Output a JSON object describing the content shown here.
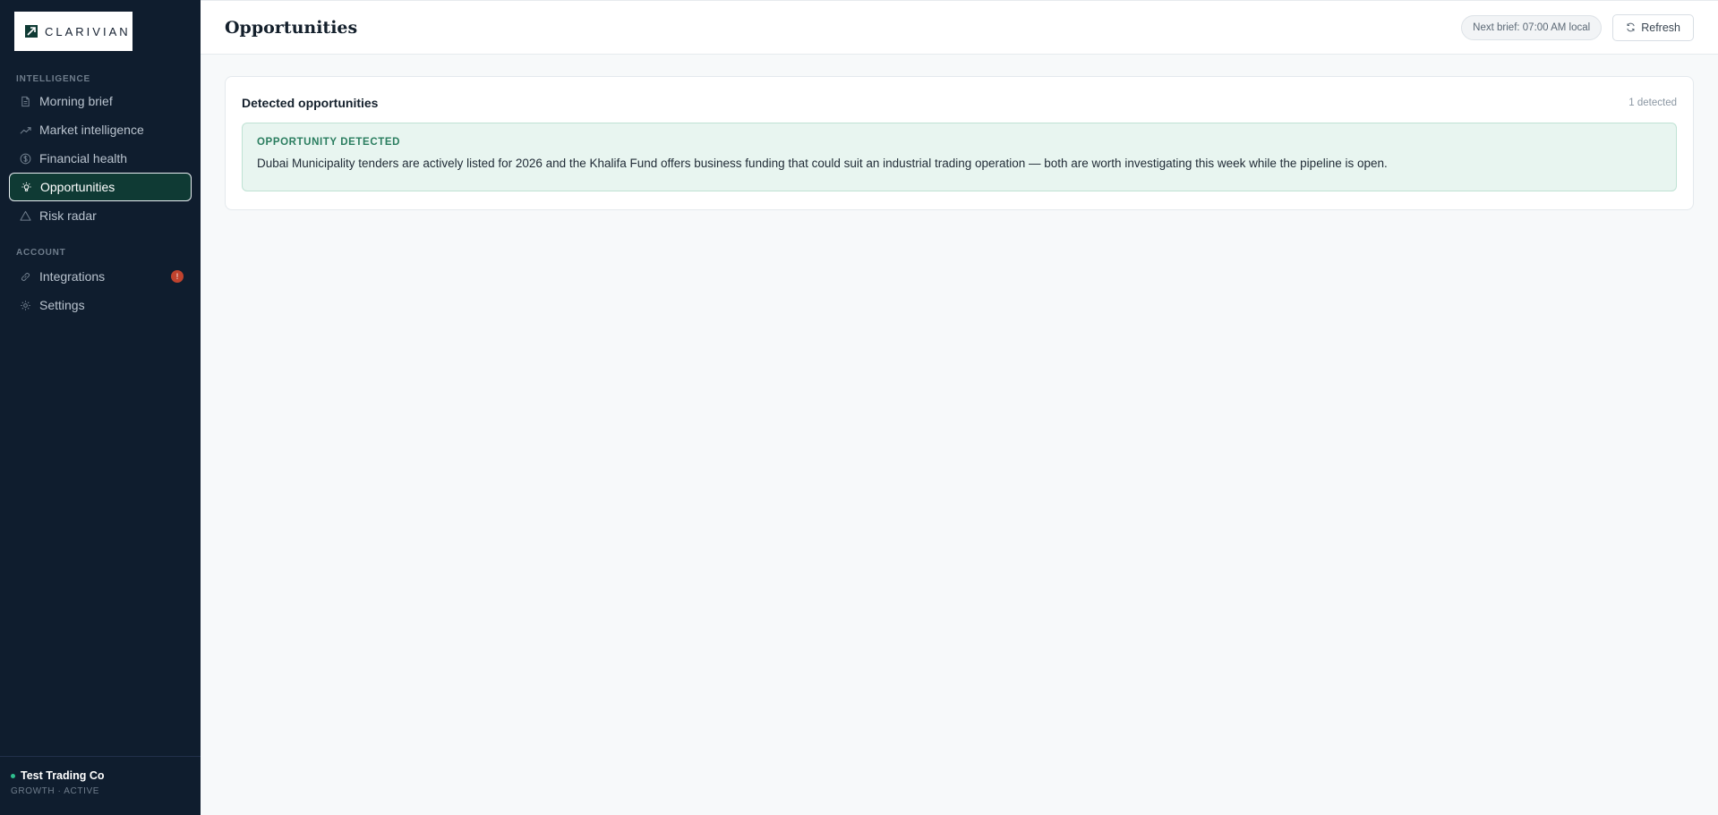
{
  "brand": {
    "name": "CLARIVIAN"
  },
  "sidebar": {
    "sections": [
      {
        "label": "INTELLIGENCE",
        "items": [
          {
            "label": "Morning brief",
            "icon": "document-icon"
          },
          {
            "label": "Market intelligence",
            "icon": "trending-up-icon"
          },
          {
            "label": "Financial health",
            "icon": "dollar-circle-icon"
          },
          {
            "label": "Opportunities",
            "icon": "lightbulb-icon",
            "active": true
          },
          {
            "label": "Risk radar",
            "icon": "warning-triangle-icon"
          }
        ]
      },
      {
        "label": "ACCOUNT",
        "items": [
          {
            "label": "Integrations",
            "icon": "link-icon",
            "badge": "!"
          },
          {
            "label": "Settings",
            "icon": "gear-icon"
          }
        ]
      }
    ],
    "footer": {
      "company": "Test Trading Co",
      "plan_status": "GROWTH · ACTIVE"
    }
  },
  "header": {
    "title": "Opportunities",
    "next_brief": "Next brief: 07:00 AM local",
    "refresh_label": "Refresh"
  },
  "card": {
    "title": "Detected opportunities",
    "count": "1 detected",
    "opportunities": [
      {
        "label": "OPPORTUNITY DETECTED",
        "text": "Dubai Municipality tenders are actively listed for 2026 and the Khalifa Fund offers business funding that could suit an industrial trading operation — both are worth investigating this week while the pipeline is open."
      }
    ]
  },
  "colors": {
    "sidebar_bg": "#0f1d2e",
    "active_item_bg": "#0f3a34",
    "accent_green": "#2a7d5f",
    "alert_red": "#c0432e"
  }
}
